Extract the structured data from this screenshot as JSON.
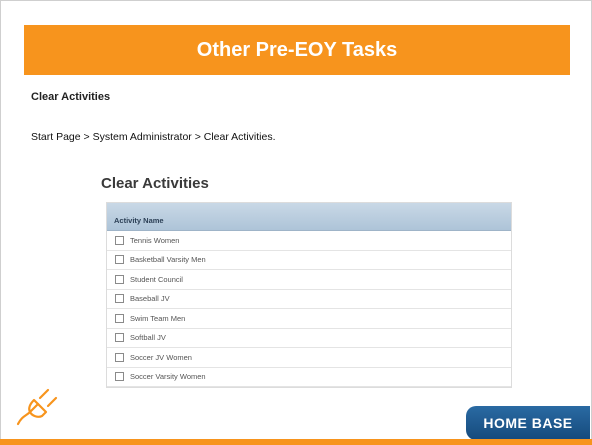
{
  "slide": {
    "title": "Other Pre-EOY Tasks",
    "subheading": "Clear Activities",
    "breadcrumb": "Start Page > System Administrator > Clear Activities."
  },
  "screenshot": {
    "title": "Clear Activities",
    "column_header": "Activity Name",
    "rows": [
      "Tennis Women",
      "Basketball Varsity Men",
      "Student Council",
      "Baseball JV",
      "Swim Team Men",
      "Softball JV",
      "Soccer JV Women",
      "Soccer Varsity Women"
    ]
  },
  "logo": {
    "text": "HOME BASE"
  },
  "colors": {
    "accent": "#f7941d",
    "logo_blue": "#1f5f96"
  },
  "icons": {
    "corner": "plug-icon"
  }
}
